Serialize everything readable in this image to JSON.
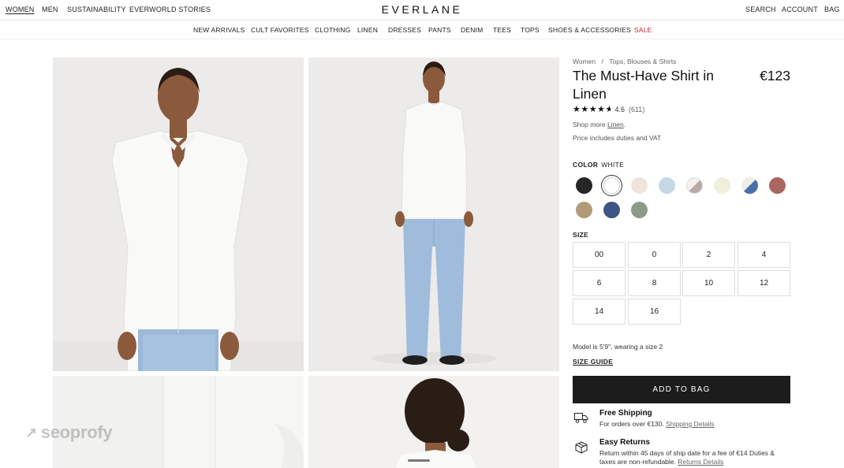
{
  "topnav": {
    "left": [
      "WOMEN",
      "MEN",
      "SUSTAINABILITY",
      "EVERWORLD STORIES"
    ],
    "logo": "EVERLANE",
    "right": [
      "SEARCH",
      "ACCOUNT",
      "BAG"
    ]
  },
  "catnav": [
    "NEW ARRIVALS",
    "CULT FAVORITES",
    "CLOTHING",
    "LINEN",
    "DRESSES",
    "PANTS",
    "DENIM",
    "TEES",
    "TOPS",
    "SHOES & ACCESSORIES",
    "SALE"
  ],
  "breadcrumb": {
    "level1": "Women",
    "sep": "/",
    "level2": "Tops, Blouses & Shirts"
  },
  "product": {
    "title": "The Must-Have Shirt in Linen",
    "price": "€123",
    "rating_value": "4.6",
    "rating_count": "(611)",
    "rating": 4.6,
    "shop_more_prefix": "Shop more",
    "shop_more_link": "Linen",
    "shop_more_suffix": ".",
    "vat_note": "Price includes duties and VAT"
  },
  "color": {
    "label": "COLOR",
    "selected": "WHITE",
    "swatches": [
      {
        "name": "black",
        "hex": "#262626"
      },
      {
        "name": "white",
        "hex": "#ffffff",
        "selected": true
      },
      {
        "name": "cream",
        "hex": "#efe5da"
      },
      {
        "name": "light-blue",
        "hex": "#c6d7e6"
      },
      {
        "name": "grey-white-split",
        "hex": "#b7aaa7"
      },
      {
        "name": "ivory",
        "hex": "#efefdc"
      },
      {
        "name": "blue-white-split",
        "hex": "#4a6fa8"
      },
      {
        "name": "rose-brown",
        "hex": "#a8665f"
      },
      {
        "name": "khaki",
        "hex": "#b09a78"
      },
      {
        "name": "navy",
        "hex": "#3d5584"
      },
      {
        "name": "sage",
        "hex": "#8e9987"
      }
    ]
  },
  "size": {
    "label": "SIZE",
    "options": [
      "00",
      "0",
      "2",
      "4",
      "6",
      "8",
      "10",
      "12",
      "14",
      "16"
    ]
  },
  "model_note": "Model is 5'9\", wearing a size 2",
  "size_guide": "SIZE GUIDE",
  "add_to_bag": "ADD TO BAG",
  "shipping": {
    "title": "Free Shipping",
    "text": "For orders over €130.",
    "link": "Shipping Details"
  },
  "returns": {
    "title": "Easy Returns",
    "text": "Return within 45 days of ship date for a fee of €14 Duties & taxes are non-refundable.",
    "link": "Returns Details"
  },
  "watermark": "seoprofy",
  "icons": [
    "truck-icon",
    "box-icon",
    "arrow-up-right-icon"
  ]
}
